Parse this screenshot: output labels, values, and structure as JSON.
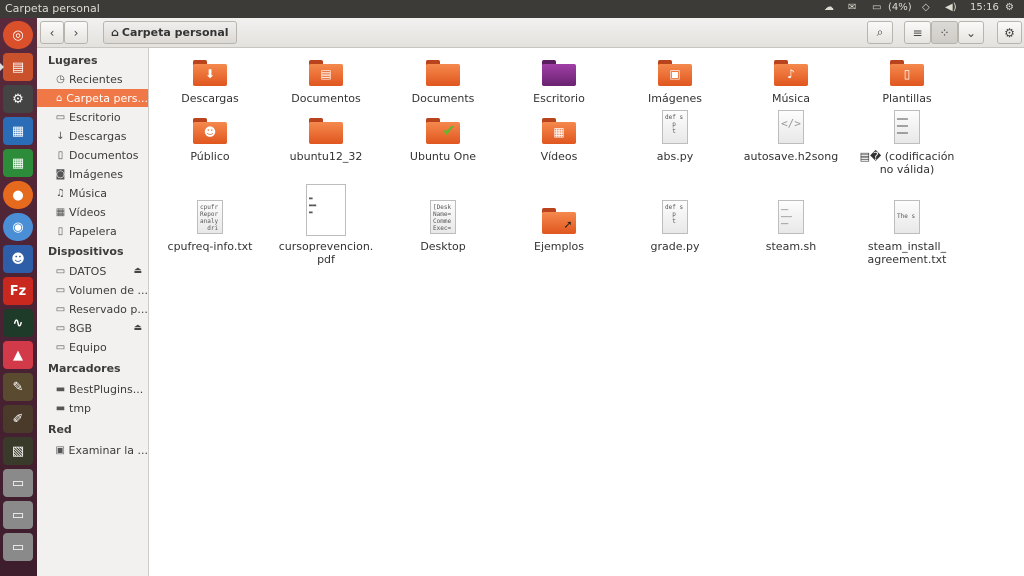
{
  "window": {
    "title": "Carpeta personal"
  },
  "indicators": {
    "battery": "(4%)",
    "time": "15:16"
  },
  "path": {
    "label": "Carpeta personal"
  },
  "sidebar": {
    "lugares": {
      "header": "Lugares",
      "items": [
        {
          "label": "Recientes",
          "icon": "clock-icon"
        },
        {
          "label": "Carpeta pers...",
          "icon": "home-icon"
        },
        {
          "label": "Escritorio",
          "icon": "desktop-icon"
        },
        {
          "label": "Descargas",
          "icon": "download-icon"
        },
        {
          "label": "Documentos",
          "icon": "document-icon"
        },
        {
          "label": "Imágenes",
          "icon": "camera-icon"
        },
        {
          "label": "Música",
          "icon": "music-icon"
        },
        {
          "label": "Vídeos",
          "icon": "film-icon"
        },
        {
          "label": "Papelera",
          "icon": "trash-icon"
        }
      ]
    },
    "dispositivos": {
      "header": "Dispositivos",
      "items": [
        {
          "label": "DATOS",
          "icon": "drive-icon"
        },
        {
          "label": "Volumen de ...",
          "icon": "drive-icon"
        },
        {
          "label": "Reservado p...",
          "icon": "drive-icon"
        },
        {
          "label": "8GB",
          "icon": "drive-icon"
        },
        {
          "label": "Equipo",
          "icon": "computer-icon"
        }
      ]
    },
    "marcadores": {
      "header": "Marcadores",
      "items": [
        {
          "label": "BestPlugins...",
          "icon": "folder-icon"
        },
        {
          "label": "tmp",
          "icon": "folder-icon"
        }
      ]
    },
    "red": {
      "header": "Red",
      "items": [
        {
          "label": "Examinar la ...",
          "icon": "network-icon"
        }
      ]
    }
  },
  "files": [
    {
      "name": "Descargas",
      "type": "folder",
      "emblem": "download-icon"
    },
    {
      "name": "Documentos",
      "type": "folder",
      "emblem": "document-icon"
    },
    {
      "name": "Documents",
      "type": "folder"
    },
    {
      "name": "Escritorio",
      "type": "folder-purple"
    },
    {
      "name": "Imágenes",
      "type": "folder",
      "emblem": "picture-icon"
    },
    {
      "name": "Música",
      "type": "folder",
      "emblem": "music-icon"
    },
    {
      "name": "Plantillas",
      "type": "folder",
      "emblem": "template-icon"
    },
    {
      "name": "Público",
      "type": "folder",
      "emblem": "person-icon"
    },
    {
      "name": "ubuntu12_32",
      "type": "folder"
    },
    {
      "name": "Ubuntu One",
      "type": "folder",
      "emblem": "check-icon"
    },
    {
      "name": "Vídeos",
      "type": "folder",
      "emblem": "film-icon"
    },
    {
      "name": "abs.py",
      "type": "text",
      "preview": "def s\n  p\n  t"
    },
    {
      "name": "autosave.h2song",
      "type": "code"
    },
    {
      "name": "▤� (codificación no válida)",
      "type": "text"
    },
    {
      "name": "cpufreq-info.txt",
      "type": "text",
      "preview": "cpufr\nRepor\nanaly\n  dri"
    },
    {
      "name": "cursoprevencion.pdf",
      "type": "pdf"
    },
    {
      "name": "Desktop",
      "type": "text",
      "preview": "[Desk\nName=\nComme\nExec="
    },
    {
      "name": "Ejemplos",
      "type": "folder",
      "emblem": "link-icon"
    },
    {
      "name": "grade.py",
      "type": "text",
      "preview": "def s\n  p\n  t"
    },
    {
      "name": "steam.sh",
      "type": "text"
    },
    {
      "name": "steam_install_agreement.txt",
      "type": "text",
      "preview": "The s"
    }
  ],
  "file_labels": {
    "codificacion": "▤� (codificación\nno válida)",
    "cursoprevencion": "cursoprevencion.\npdf",
    "steam_agree": "steam_install_\nagreement.txt"
  }
}
